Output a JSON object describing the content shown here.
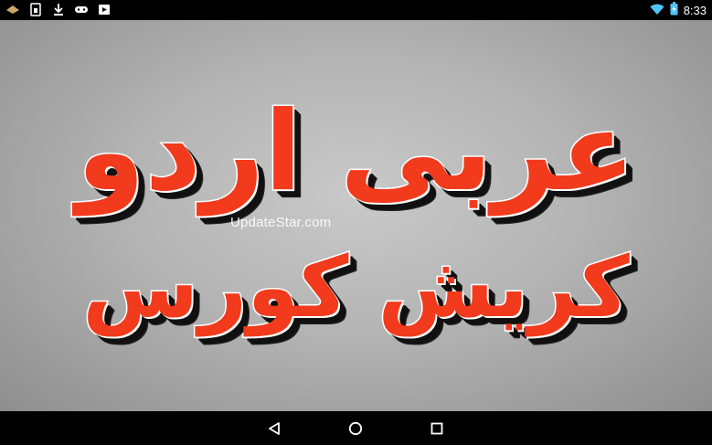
{
  "status_bar": {
    "time": "8:33",
    "left_icons": [
      "keyboard-icon",
      "sim-icon",
      "download-icon",
      "game-controller-icon",
      "media-icon"
    ],
    "right_icons": [
      "wifi-icon",
      "battery-icon"
    ]
  },
  "main": {
    "title_line1": "عربی اردو",
    "title_line2": "کریش کورس",
    "watermark": "UpdateStar.com"
  },
  "nav": {
    "buttons": [
      "back-icon",
      "home-icon",
      "recents-icon"
    ]
  },
  "colors": {
    "title_fill": "#f23a1c",
    "title_outline": "#ffffff",
    "title_shadow": "#111111",
    "background": "#bcbcbc"
  }
}
